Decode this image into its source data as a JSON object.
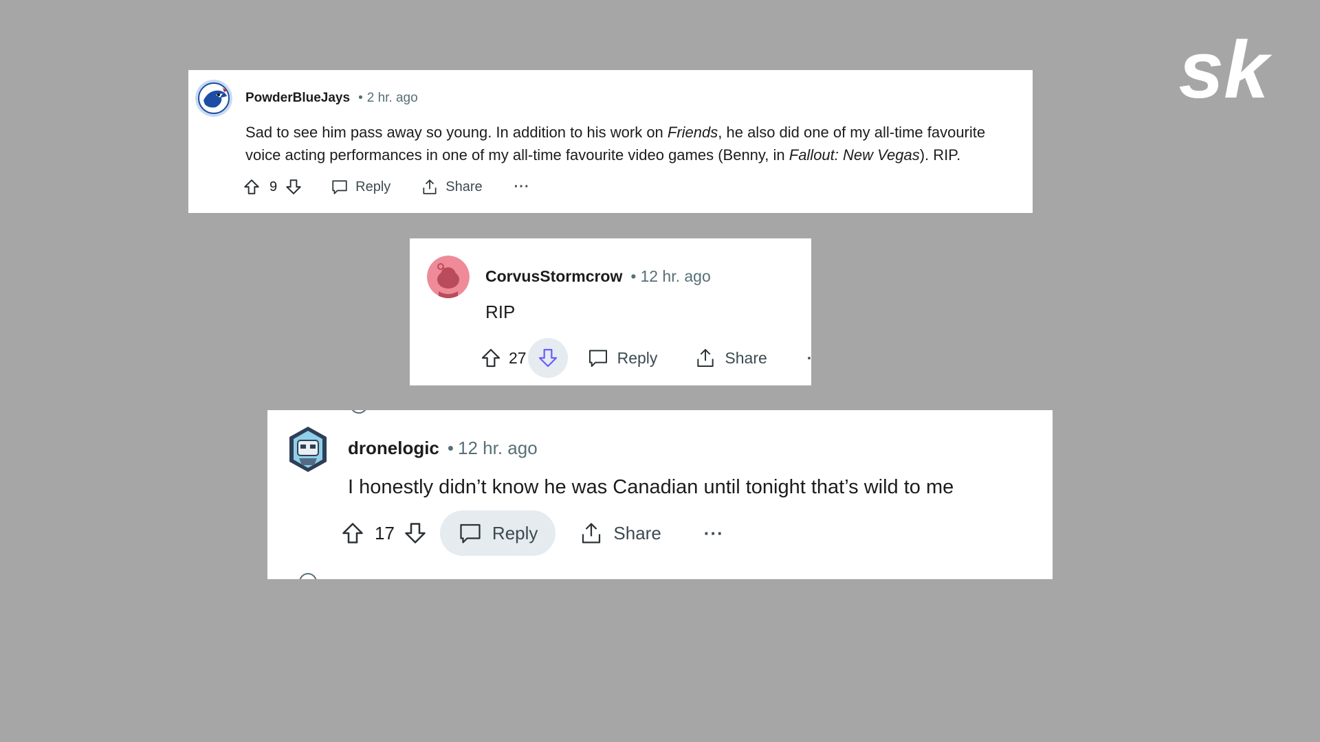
{
  "comments": [
    {
      "author": "PowderBlueJays",
      "separator": "•",
      "time": "2 hr. ago",
      "body_parts": [
        {
          "text": "Sad to see him pass away so young. In addition to his work on ",
          "italic": false
        },
        {
          "text": "Friends",
          "italic": true
        },
        {
          "text": ", he also did one of my all-time favourite voice acting performances in one of my all-time favourite video games (Benny, in ",
          "italic": false
        },
        {
          "text": "Fallout: New Vegas",
          "italic": true
        },
        {
          "text": "). RIP.",
          "italic": false
        }
      ],
      "votes": "9",
      "reply_label": "Reply",
      "share_label": "Share",
      "more_label": "···",
      "avatar_icon": "blue-jays-avatar-icon"
    },
    {
      "author": "CorvusStormcrow",
      "separator": "•",
      "time": "12 hr. ago",
      "body_parts": [
        {
          "text": "RIP",
          "italic": false
        }
      ],
      "votes": "27",
      "downvote_active": true,
      "reply_label": "Reply",
      "share_label": "Share",
      "more_label": "···",
      "avatar_icon": "snoo-avatar-icon"
    },
    {
      "author": "dronelogic",
      "separator": "•",
      "time": "12 hr. ago",
      "body_parts": [
        {
          "text": "I honestly didn’t know he was Canadian until tonight that’s wild to me",
          "italic": false
        }
      ],
      "votes": "17",
      "reply_hover": true,
      "reply_label": "Reply",
      "share_label": "Share",
      "more_label": "···",
      "avatar_icon": "robot-avatar-icon"
    }
  ],
  "logo": {
    "text": "sk",
    "icon": "sportskeeda-logo-icon"
  },
  "colors": {
    "background": "#a6a6a6",
    "card": "#ffffff",
    "meta_gray": "#576f76",
    "vote_active": "#6a5cff",
    "pill_bg": "#e5ebee",
    "avatar_pink": "#ef8a99"
  }
}
